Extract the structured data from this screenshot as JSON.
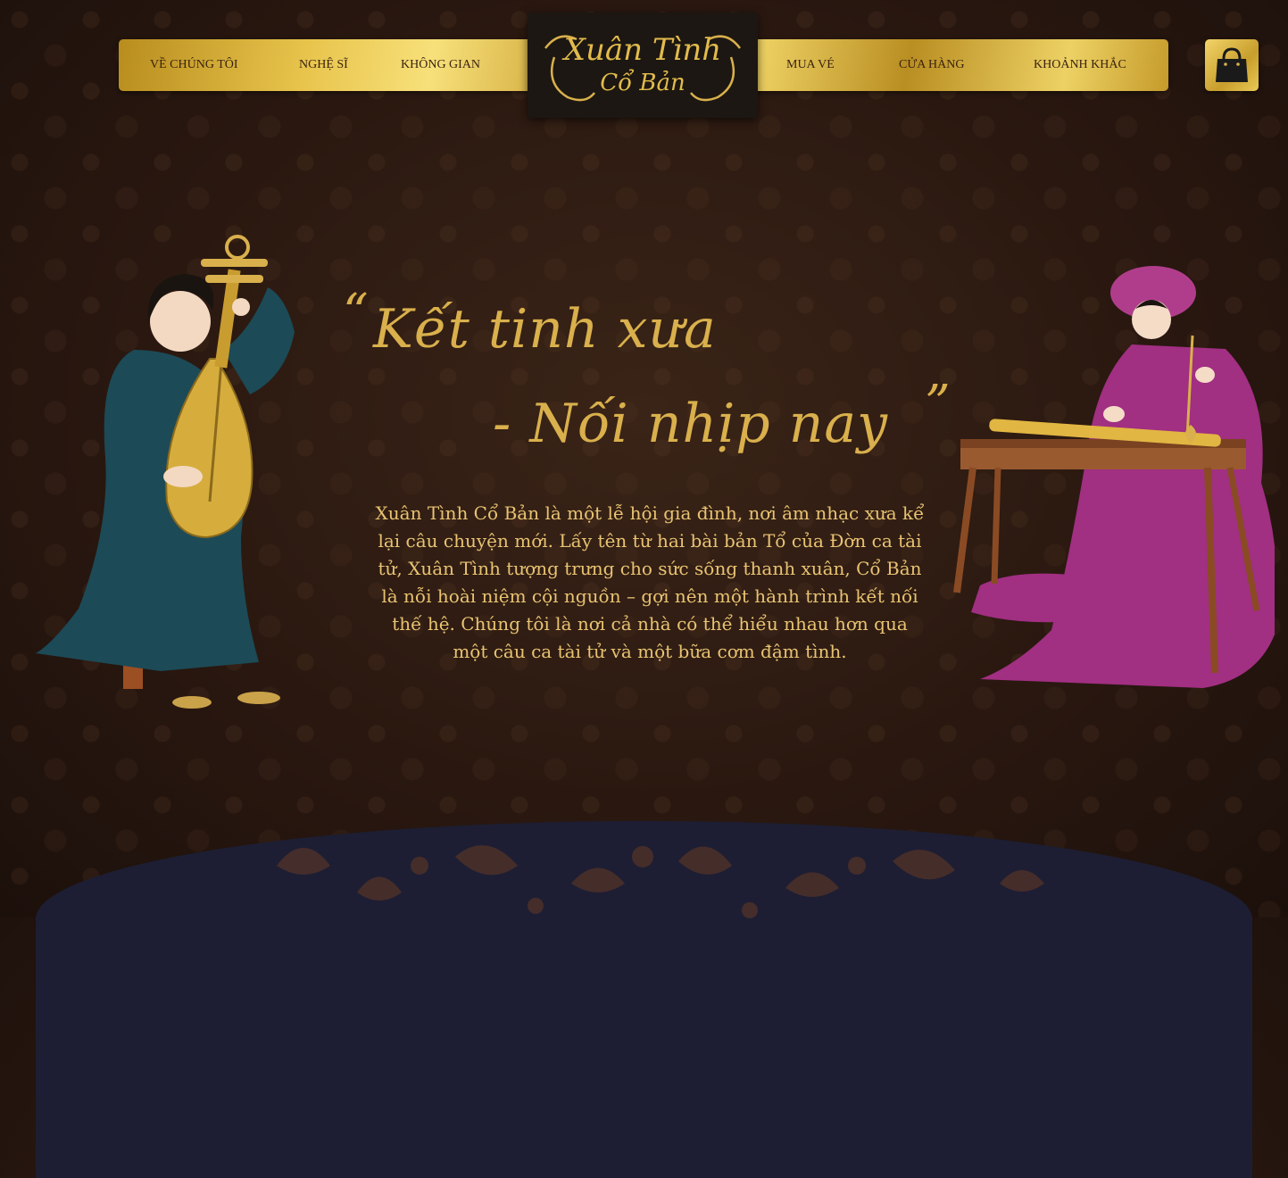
{
  "nav": {
    "left_items": [
      "VỀ CHÚNG TÔI",
      "NGHỆ SĨ",
      "KHÔNG GIAN"
    ],
    "right_items": [
      "MUA VÉ",
      "CỬA HÀNG",
      "KHOẢNH KHẮC"
    ]
  },
  "logo": {
    "line1": "Xuân Tình",
    "line2": "Cổ Bản"
  },
  "cart": {
    "icon": "shopping-bag-icon"
  },
  "hero": {
    "quote_open": "“",
    "line1": "Kết tinh xưa",
    "line2": "- Nối nhịp nay",
    "quote_close": "”",
    "description": "Xuân Tình Cổ Bản là một lễ hội gia đình, nơi âm nhạc xưa kể lại câu chuyện mới. Lấy tên từ hai bài bản Tổ của Đờn ca tài tử, Xuân Tình tượng trưng cho sức sống thanh xuân, Cổ Bản là nỗi hoài niệm cội nguồn – gợi nên một hành trình kết nối thế hệ. Chúng tôi là nơi cả nhà có thể hiểu nhau hơn qua một câu ca tài tử và một bữa cơm đậm tình."
  },
  "colors": {
    "gold": "#d9b04c",
    "background": "#2a1810",
    "navy": "#1d1e33"
  }
}
